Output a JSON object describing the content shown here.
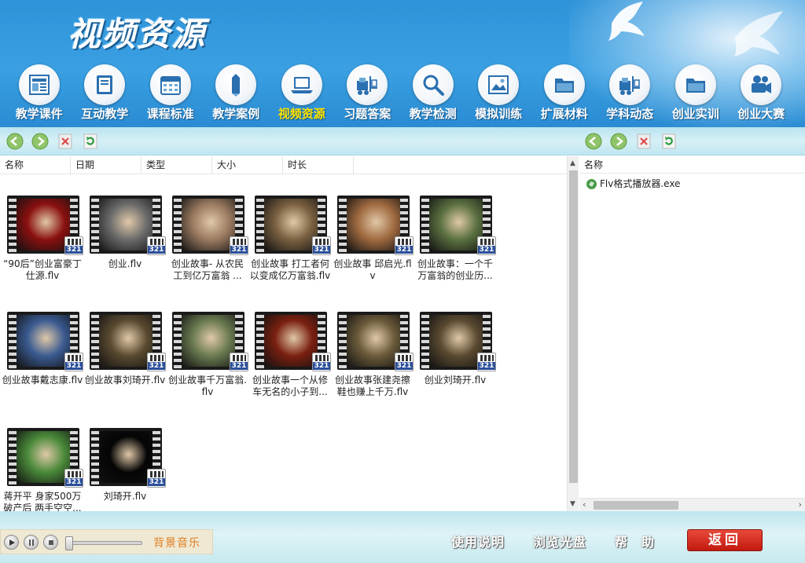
{
  "header": {
    "title": "视频资源",
    "nav": [
      {
        "label": "教学课件",
        "icon": "courseware-icon"
      },
      {
        "label": "互动教学",
        "icon": "book-icon"
      },
      {
        "label": "课程标准",
        "icon": "calendar-icon"
      },
      {
        "label": "教学案例",
        "icon": "pencil-icon"
      },
      {
        "label": "视频资源",
        "icon": "laptop-icon",
        "active": true
      },
      {
        "label": "习题答案",
        "icon": "forklift-icon"
      },
      {
        "label": "教学检测",
        "icon": "magnifier-icon"
      },
      {
        "label": "模拟训练",
        "icon": "picture-icon"
      },
      {
        "label": "扩展材料",
        "icon": "folder-icon"
      },
      {
        "label": "学科动态",
        "icon": "forklift-icon"
      },
      {
        "label": "创业实训",
        "icon": "folder-icon"
      },
      {
        "label": "创业大赛",
        "icon": "video-camera-icon"
      }
    ]
  },
  "left_pane": {
    "columns": [
      "名称",
      "日期",
      "类型",
      "大小",
      "时长"
    ],
    "files": [
      {
        "name": "“90后”创业富豪丁仕源.flv",
        "color": "#8a1010"
      },
      {
        "name": "创业.flv",
        "color": "#6b6b6b"
      },
      {
        "name": "创业故事- 从农民工到亿万富翁 ...",
        "color": "#9a7a60"
      },
      {
        "name": "创业故事 打工者何以变成亿万富翁.flv",
        "color": "#7a6040"
      },
      {
        "name": "创业故事 邱启光.flv",
        "color": "#a06a40"
      },
      {
        "name": "创业故事：一个千万富翁的创业历...",
        "color": "#5a7040"
      },
      {
        "name": "创业故事戴志康.flv",
        "color": "#3a5a90"
      },
      {
        "name": "创业故事刘琦开.flv",
        "color": "#5a4a30"
      },
      {
        "name": "创业故事千万富翁.flv",
        "color": "#6a7a50"
      },
      {
        "name": "创业故事一个从修车无名的小子到...",
        "color": "#7a2010"
      },
      {
        "name": "创业故事张建尧擦鞋也赚上千万.flv",
        "color": "#6a5a3a"
      },
      {
        "name": "创业刘琦开.flv",
        "color": "#5a4a30"
      },
      {
        "name": "蒋开平 身家500万破产后 两手空空...",
        "color": "#4a8a3a"
      },
      {
        "name": "刘琦开.flv",
        "color": "#050505"
      }
    ]
  },
  "right_pane": {
    "column": "名称",
    "files": [
      {
        "name": "Flv格式播放器.exe"
      }
    ]
  },
  "footer": {
    "music_label": "背景音乐",
    "manual": "使用说明",
    "browse_disc": "浏览光盘",
    "help": "帮　助",
    "back": "返回"
  }
}
